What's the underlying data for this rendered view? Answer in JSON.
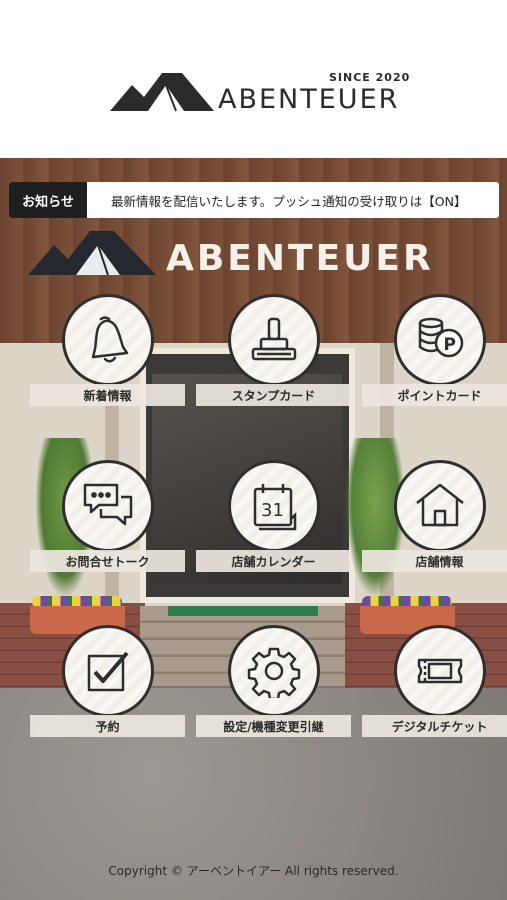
{
  "header": {
    "since": "SINCE 2020",
    "brand": "ABENTEUER"
  },
  "sign": {
    "brand": "ABENTEUER"
  },
  "notice": {
    "label": "お知らせ",
    "text": "最新情報を配信いたします。プッシュ通知の受け取りは【ON】"
  },
  "menu": {
    "items": [
      {
        "label": "新着情報",
        "icon": "bell-icon"
      },
      {
        "label": "スタンプカード",
        "icon": "stamp-icon"
      },
      {
        "label": "ポイントカード",
        "icon": "coins-icon"
      },
      {
        "label": "お問合せトーク",
        "icon": "chat-icon"
      },
      {
        "label": "店舗カレンダー",
        "icon": "calendar-icon"
      },
      {
        "label": "店舗情報",
        "icon": "house-icon"
      },
      {
        "label": "予約",
        "icon": "checkbox-icon"
      },
      {
        "label": "設定/機種変更引継",
        "icon": "gear-icon"
      },
      {
        "label": "デジタルチケット",
        "icon": "ticket-icon"
      }
    ],
    "calendar_day": "31"
  },
  "footer": {
    "copyright": "Copyright © アーベントイアー All rights reserved."
  },
  "colors": {
    "dark": "#2e2e2e",
    "notice_label_bg": "#1f1f1f"
  }
}
